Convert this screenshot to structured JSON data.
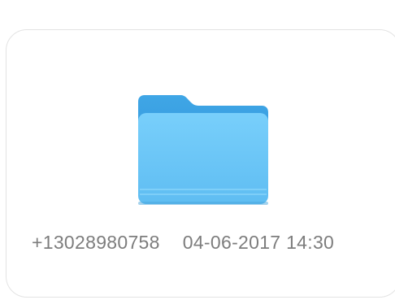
{
  "item": {
    "icon": "folder-icon",
    "name": "+13028980758",
    "date": "04-06-2017 14:30"
  },
  "colors": {
    "folder_front": "#6ec8f8",
    "folder_back": "#3a9fe0",
    "label_text": "#7d7d7d",
    "card_border": "#e3e3e3"
  }
}
